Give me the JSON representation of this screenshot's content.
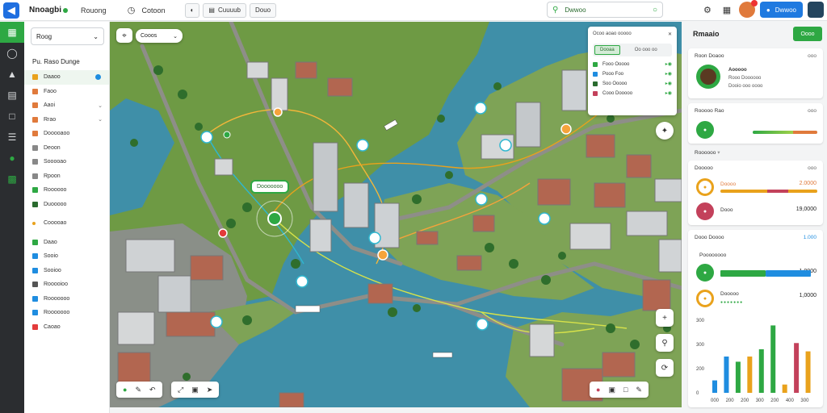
{
  "topbar": {
    "app_title": "Nnoagbi",
    "menu_text": "Rouong",
    "view_label": "Cotoon",
    "tool_a": "Cuuuub",
    "tool_b": "Douo",
    "search_value": "Dwwoo",
    "primary_button": "Dwwoo"
  },
  "rail": {
    "items": [
      "grid-icon",
      "pin-icon",
      "layers-icon",
      "chart-icon",
      "chat-icon",
      "doc-icon",
      "leaf-icon",
      "table-icon"
    ]
  },
  "sidebar": {
    "select_value": "Roog",
    "heading": "Pu. Raso Dunge",
    "items": [
      {
        "label": "Daaoo",
        "color": "#e9a21c",
        "selected": true,
        "dot": true
      },
      {
        "label": "Faoo",
        "color": "#e07a3c"
      },
      {
        "label": "Aaoi",
        "color": "#e07a3c",
        "chev": true
      },
      {
        "label": "Rrao",
        "color": "#e07a3c",
        "chev": true
      },
      {
        "label": "Dooooaoo",
        "color": "#e07a3c"
      },
      {
        "label": "Deoon",
        "color": "#888888"
      },
      {
        "label": "Sooooao",
        "color": "#888888"
      },
      {
        "label": "Rpoon",
        "color": "#888888"
      },
      {
        "label": "Roooooo",
        "color": "#2ea843"
      },
      {
        "label": "Duooooo",
        "color": "#2a6b2f"
      },
      {
        "label": "Cooooao",
        "color": "#e9a21c",
        "dot_green": true
      },
      {
        "label": "Daao",
        "color": "#2ea843"
      },
      {
        "label": "Sooio",
        "color": "#1f8de0"
      },
      {
        "label": "Sooioo",
        "color": "#1f8de0"
      },
      {
        "label": "Rooooioo",
        "color": "#555555"
      },
      {
        "label": "Rooooooo",
        "color": "#1f8de0"
      },
      {
        "label": "Rooooooo",
        "color": "#1f8de0"
      },
      {
        "label": "Caoao",
        "color": "#e33b3b"
      }
    ]
  },
  "map": {
    "layer_select": "Cooos",
    "location_label": "Dooooooo",
    "panel": {
      "title": "Ocoo aoao ooooo",
      "tab_active": "Dooaa",
      "tab_other": "Oo ooo oo",
      "rows": [
        {
          "label": "Fooo Ooooo",
          "color": "#2ea843"
        },
        {
          "label": "Pooo Foo",
          "color": "#1f8de0"
        },
        {
          "label": "Soo Ooooo",
          "color": "#2a6b2f"
        },
        {
          "label": "Cooo Dooooo",
          "color": "#c3415b"
        }
      ]
    }
  },
  "rpanel": {
    "title": "Rmaaio",
    "button": "Oooo",
    "profile": {
      "title": "Roon Doaoo",
      "value": "ooo",
      "name": "Aooooo",
      "line1": "Rooo Doooooo",
      "line2": "Dooio ooo oooo"
    },
    "progress1": {
      "title": "Rooooo Rao",
      "value": "ooo",
      "fraction": 0.62
    },
    "sub_heading": "Roooooo",
    "card3": {
      "title": "Dooooo",
      "value": "ooo",
      "row1_label": "Doooo",
      "row1_value": "2.0000",
      "row2_label": "Dooo",
      "row2_value": "19,0000"
    },
    "card4": {
      "title": "Dooo Doooo",
      "value": "1.000",
      "sub": "Poooooooo",
      "row1_value": "1.0000",
      "row2_label": "Dooooo",
      "row2_value": "1,0000",
      "chart_values": [
        1.2,
        3.5,
        3.0,
        3.5,
        4.2,
        6.5,
        0.8,
        4.8,
        4.0
      ],
      "chart_colors": [
        "#1f8de0",
        "#1f8de0",
        "#2ea843",
        "#e9a21c",
        "#2ea843",
        "#2ea843",
        "#e9a21c",
        "#c3415b",
        "#e9a21c"
      ],
      "y_ticks": [
        "0",
        "200",
        "300",
        "300"
      ],
      "x_ticks": [
        "000",
        "200",
        "200",
        "300",
        "200",
        "400",
        "300"
      ]
    }
  }
}
